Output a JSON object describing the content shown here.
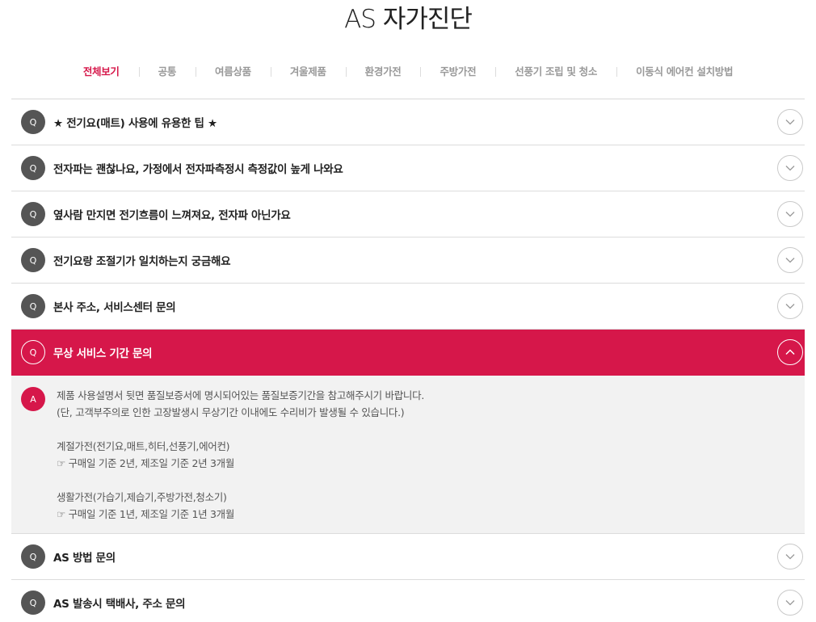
{
  "title": "AS 자가진단",
  "tabs": [
    {
      "label": "전체보기"
    },
    {
      "label": "공통"
    },
    {
      "label": "여름상품"
    },
    {
      "label": "겨울제품"
    },
    {
      "label": "환경가전"
    },
    {
      "label": "주방가전"
    },
    {
      "label": "선풍기 조립 및 청소"
    },
    {
      "label": "이동식 에어컨 설치방법"
    }
  ],
  "active_tab": "전체보기",
  "q_badge": "Q",
  "a_badge": "A",
  "faqs": [
    {
      "question": "★ 전기요(매트) 사용에 유용한 팁 ★"
    },
    {
      "question": "전자파는 괜찮나요, 가정에서 전자파측정시 측정값이 높게 나와요"
    },
    {
      "question": "옆사람 만지면 전기흐름이 느껴져요, 전자파 아닌가요"
    },
    {
      "question": "전기요랑 조절기가 일치하는지 궁금해요"
    },
    {
      "question": "본사 주소, 서비스센터 문의"
    },
    {
      "question": "무상 서비스 기간 문의"
    },
    {
      "question": "AS 방법 문의"
    },
    {
      "question": "AS 발송시 택배사, 주소 문의"
    }
  ],
  "open_answer": {
    "line1": "제품 사용설명서 뒷면 품질보증서에 명시되어있는 품질보증기간을 참고해주시기 바랍니다.",
    "line2": "(단, 고객부주의로 인한 고장발생시 무상기간 이내에도 수리비가 발생될 수 있습니다.)",
    "group1_title": "계절가전(전기요,매트,히터,선풍기,에어컨)",
    "group1_detail": "☞ 구매일 기준 2년, 제조일 기준 2년 3개월",
    "group2_title": "생활가전(가습기,제습기,주방가전,청소기)",
    "group2_detail": "☞ 구매일 기준 1년, 제조일 기준 1년 3개월"
  },
  "colors": {
    "accent": "#d6174a",
    "badge": "#555555",
    "answer_bg": "#f2f2f2"
  }
}
